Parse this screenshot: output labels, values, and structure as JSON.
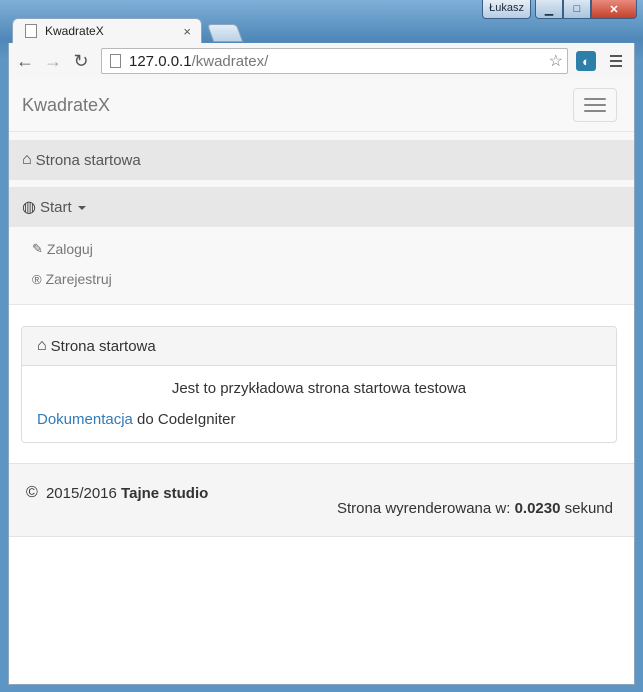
{
  "window": {
    "user": "Łukasz",
    "controls": {
      "minimize": "▁",
      "maximize": "□",
      "close": "✕"
    }
  },
  "tab": {
    "title": "KwadrateX",
    "close": "×"
  },
  "toolbar": {
    "back": "←",
    "forward": "→",
    "reload": "↻",
    "url_host": "127.0.0.1",
    "url_path": "/kwadratex/",
    "star": "☆"
  },
  "navbar": {
    "brand": "KwadrateX"
  },
  "menu": {
    "home_label": "Strona startowa",
    "start_label": "Start",
    "dropdown": [
      {
        "label": "Zaloguj",
        "icon": "pencil-icon",
        "glyph": "✎"
      },
      {
        "label": "Zarejestruj",
        "icon": "registered-icon",
        "glyph": "®"
      }
    ]
  },
  "panel": {
    "heading": "Strona startowa",
    "text": "Jest to przykładowa strona startowa testowa",
    "link_text": "Dokumentacja",
    "link_suffix": " do CodeIgniter"
  },
  "footer": {
    "copyright_symbol": "©",
    "years": " 2015/2016 ",
    "studio": "Tajne studio",
    "render_prefix": "Strona wyrenderowana w: ",
    "render_time": "0.0230",
    "render_suffix": " sekund"
  }
}
